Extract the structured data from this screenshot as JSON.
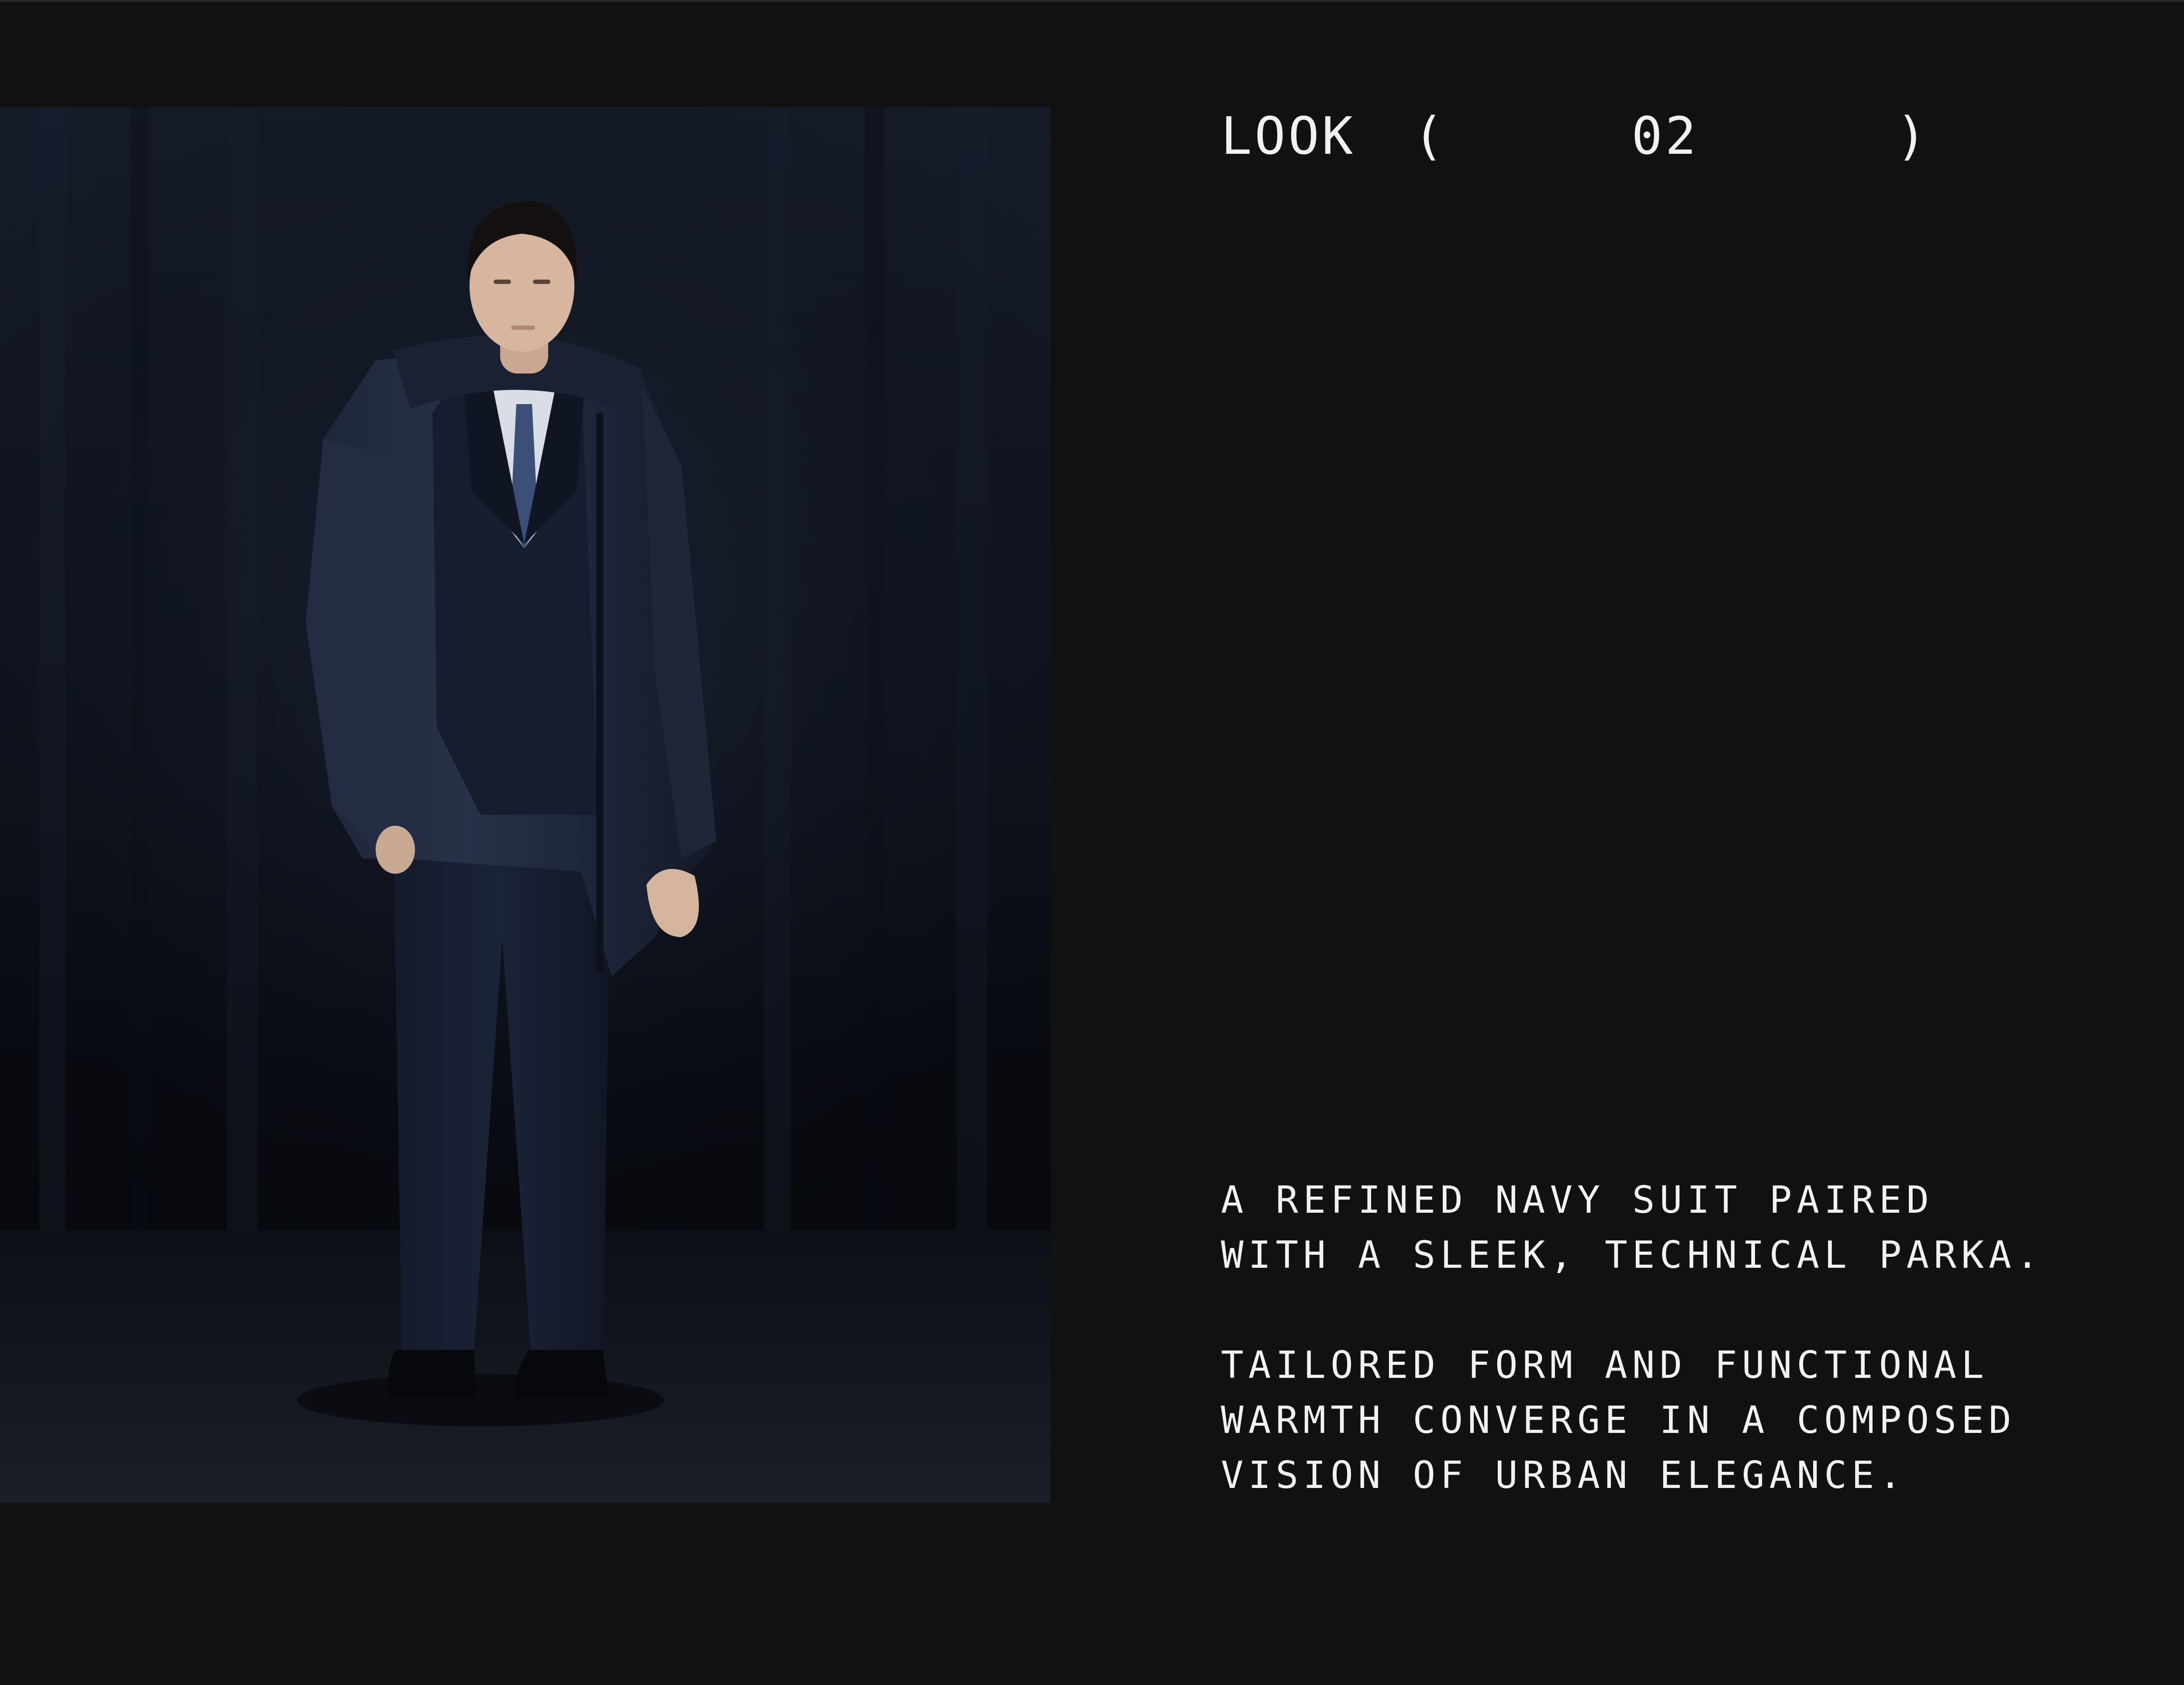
{
  "look": {
    "label": "LOOK",
    "open_paren": "(",
    "number": "02",
    "close_paren": ")"
  },
  "description": {
    "paragraph_1": [
      "A REFINED NAVY SUIT PAIRED",
      "WITH A SLEEK, TECHNICAL PARKA."
    ],
    "paragraph_2": [
      "TAILORED FORM AND FUNCTIONAL",
      "WARMTH CONVERGE IN A COMPOSED",
      "VISION OF URBAN ELEGANCE."
    ]
  },
  "colors": {
    "background": "#111111",
    "text": "#f2f2f2",
    "navy": "#1a2236"
  }
}
